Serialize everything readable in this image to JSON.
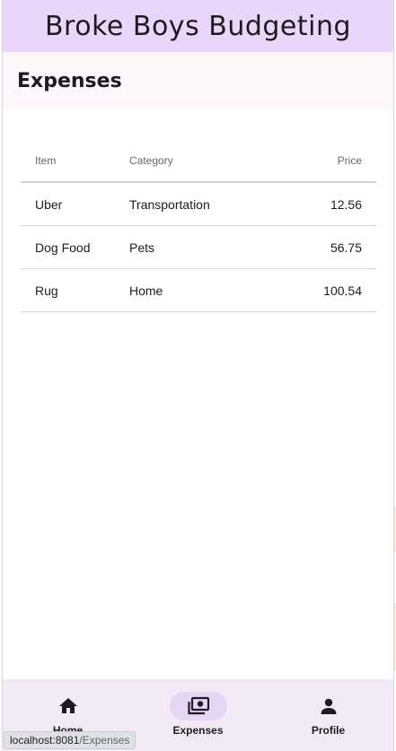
{
  "app": {
    "title": "Broke Boys Budgeting"
  },
  "section": {
    "title": "Expenses"
  },
  "table": {
    "columns": [
      "Item",
      "Category",
      "Price"
    ],
    "rows": [
      {
        "item": "Uber",
        "category": "Transportation",
        "price": "12.56"
      },
      {
        "item": "Dog Food",
        "category": "Pets",
        "price": "56.75"
      },
      {
        "item": "Rug",
        "category": "Home",
        "price": "100.54"
      }
    ]
  },
  "nav": {
    "items": [
      {
        "label": "Home",
        "icon": "home-icon",
        "active": false
      },
      {
        "label": "Expenses",
        "icon": "money-icon",
        "active": true
      },
      {
        "label": "Profile",
        "icon": "person-icon",
        "active": false
      }
    ]
  },
  "status_bar": {
    "host": "localhost:8081",
    "path": "/Expenses"
  },
  "colors": {
    "app_bar": "#ead6fb",
    "section_header": "#fdf6fb",
    "bottom_nav": "#f2ebf6",
    "active_indicator": "#e6d5f5"
  }
}
